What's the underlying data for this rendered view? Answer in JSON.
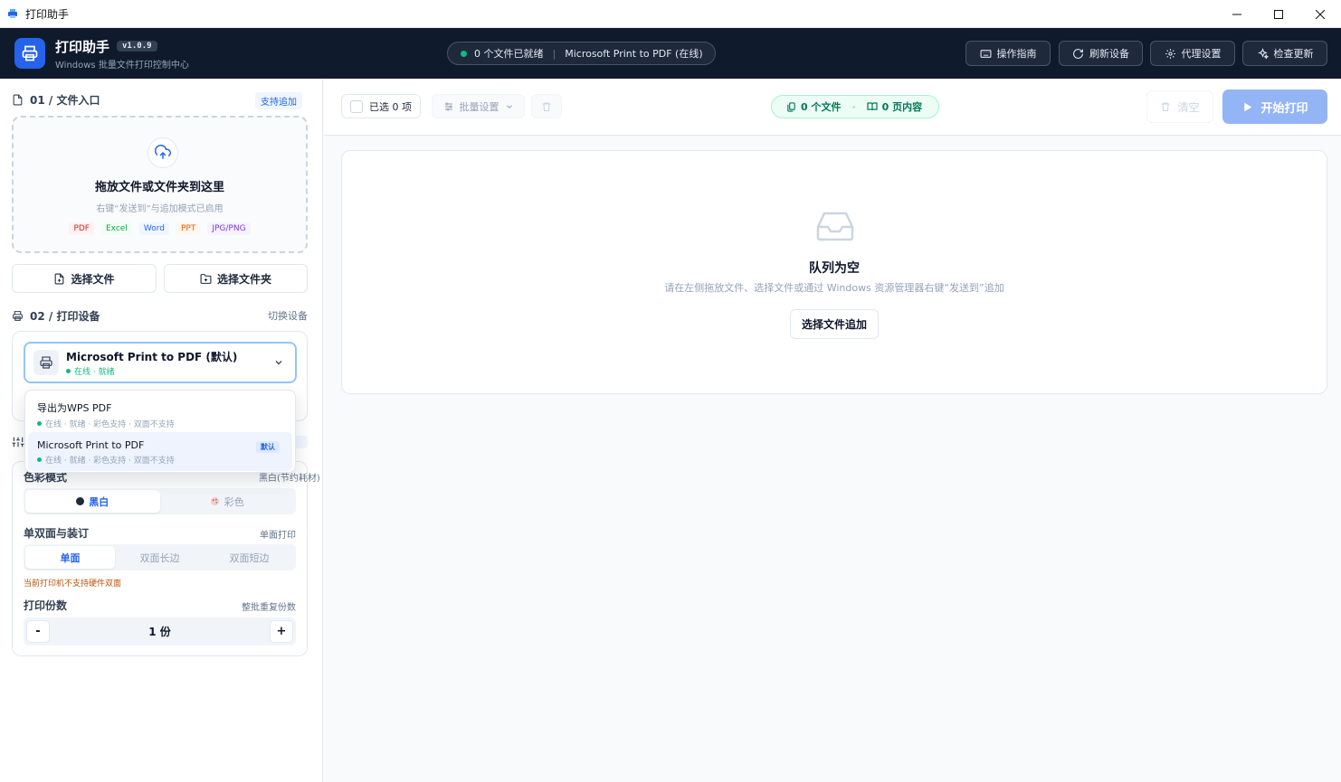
{
  "window": {
    "title": "打印助手"
  },
  "header": {
    "app_name": "打印助手",
    "version": "v1.0.9",
    "subtitle": "Windows 批量文件打印控制中心",
    "status_files": "0 个文件已就绪",
    "status_sep": "|",
    "status_printer": "Microsoft Print to PDF (在线)",
    "buttons": {
      "guide": "操作指南",
      "refresh": "刷新设备",
      "proxy": "代理设置",
      "update": "检查更新"
    }
  },
  "files_section": {
    "title": "01 / 文件入口",
    "badge": "支持追加",
    "drop_title": "拖放文件或文件夹到这里",
    "drop_hint": "右键“发送到”与追加模式已启用",
    "formats": [
      "PDF",
      "Excel",
      "Word",
      "PPT",
      "JPG/PNG"
    ],
    "select_file": "选择文件",
    "select_folder": "选择文件夹"
  },
  "device_section": {
    "title": "02 / 打印设备",
    "switch": "切换设备",
    "selected_name": "Microsoft Print to PDF (默认)",
    "selected_status": "在线 · 就绪",
    "dropdown": [
      {
        "name": "导出为WPS PDF",
        "meta": "在线 · 就绪 · 彩色支持 · 双面不支持",
        "badge": ""
      },
      {
        "name": "Microsoft Print to PDF",
        "meta": "在线 · 就绪 · 彩色支持 · 双面不支持",
        "badge": "默认"
      }
    ]
  },
  "options": {
    "color_label": "色彩模式",
    "color_value": "黑白(节约耗材)",
    "color_opts": [
      "黑白",
      "彩色"
    ],
    "duplex_label": "单双面与装订",
    "duplex_value": "单面打印",
    "duplex_opts": [
      "单面",
      "双面长边",
      "双面短边"
    ],
    "duplex_warning": "当前打印机不支持硬件双面",
    "copies_label": "打印份数",
    "copies_hint": "整批重复份数",
    "copies_value": "1 份",
    "minus": "-",
    "plus": "+"
  },
  "toolbar": {
    "selected": "已选 0 项",
    "batch": "批量设置",
    "files_count": "0 个文件",
    "pages_count": "0 页内容",
    "clear": "清空",
    "start_print": "开始打印"
  },
  "queue": {
    "empty_title": "队列为空",
    "empty_hint": "请在左侧拖放文件、选择文件或通过 Windows 资源管理器右键“发送到”追加",
    "add_button": "选择文件追加"
  },
  "colors": {
    "accent": "#2563eb",
    "header_bg": "#0f1b2d",
    "ok": "#10b981",
    "warn": "#b45309"
  }
}
